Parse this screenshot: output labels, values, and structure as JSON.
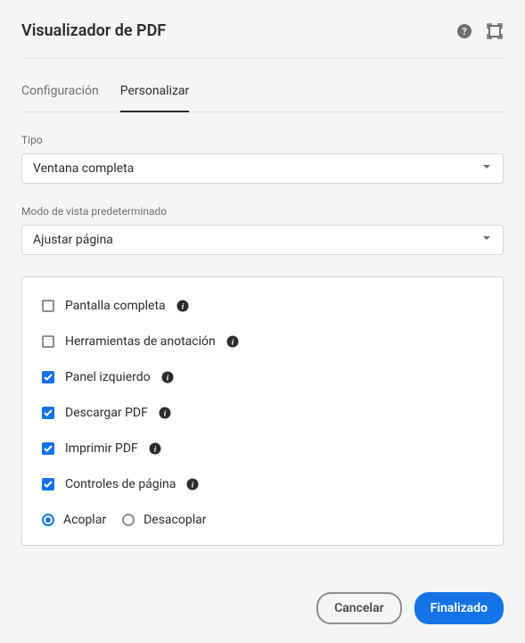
{
  "header": {
    "title": "Visualizador de PDF"
  },
  "tabs": [
    {
      "label": "Configuración",
      "active": false
    },
    {
      "label": "Personalizar",
      "active": true
    }
  ],
  "fields": {
    "type": {
      "label": "Tipo",
      "value": "Ventana completa"
    },
    "defaultViewMode": {
      "label": "Modo de vista predeterminado",
      "value": "Ajustar página"
    }
  },
  "options": {
    "fullscreen": {
      "label": "Pantalla completa",
      "checked": false
    },
    "annotationTools": {
      "label": "Herramientas de anotación",
      "checked": false
    },
    "leftPanel": {
      "label": "Panel izquierdo",
      "checked": true
    },
    "downloadPdf": {
      "label": "Descargar PDF",
      "checked": true
    },
    "printPdf": {
      "label": "Imprimir PDF",
      "checked": true
    },
    "pageControls": {
      "label": "Controles de página",
      "checked": true
    }
  },
  "dockRadio": {
    "dock": {
      "label": "Acoplar",
      "selected": true
    },
    "undock": {
      "label": "Desacoplar",
      "selected": false
    }
  },
  "footer": {
    "cancel": "Cancelar",
    "done": "Finalizado"
  }
}
